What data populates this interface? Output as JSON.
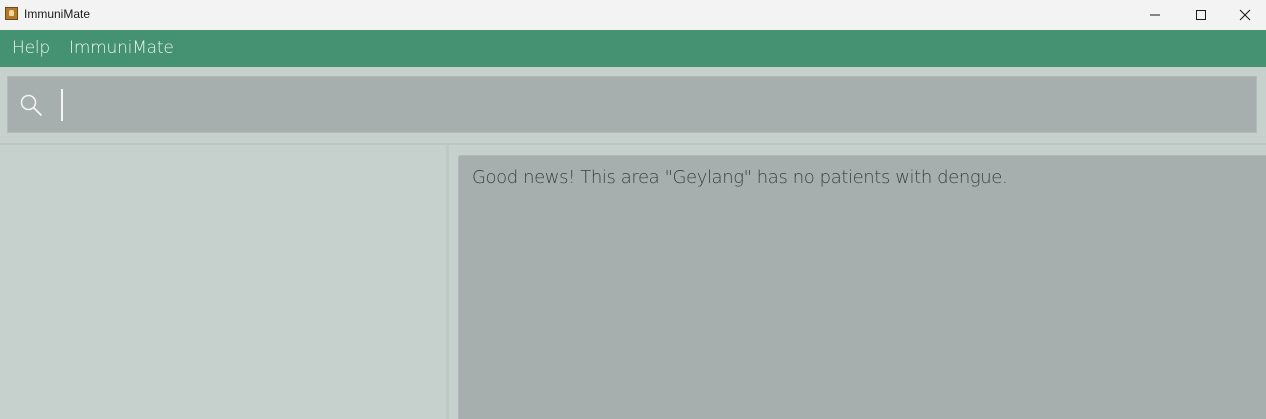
{
  "window": {
    "title": "ImmuniMate"
  },
  "menubar": {
    "items": [
      {
        "label": "Help"
      },
      {
        "label": "ImmuniMate"
      }
    ]
  },
  "command_box": {
    "value": "",
    "placeholder": "",
    "icon": "search-icon"
  },
  "result_display": {
    "text": "Good news! This area \"Geylang\" has no patients with dengue."
  },
  "colors": {
    "menubar_bg": "#459273",
    "background": "#c6d0cd",
    "panel_bg": "#a6afad",
    "titlebar_bg": "#f3f3f3"
  }
}
